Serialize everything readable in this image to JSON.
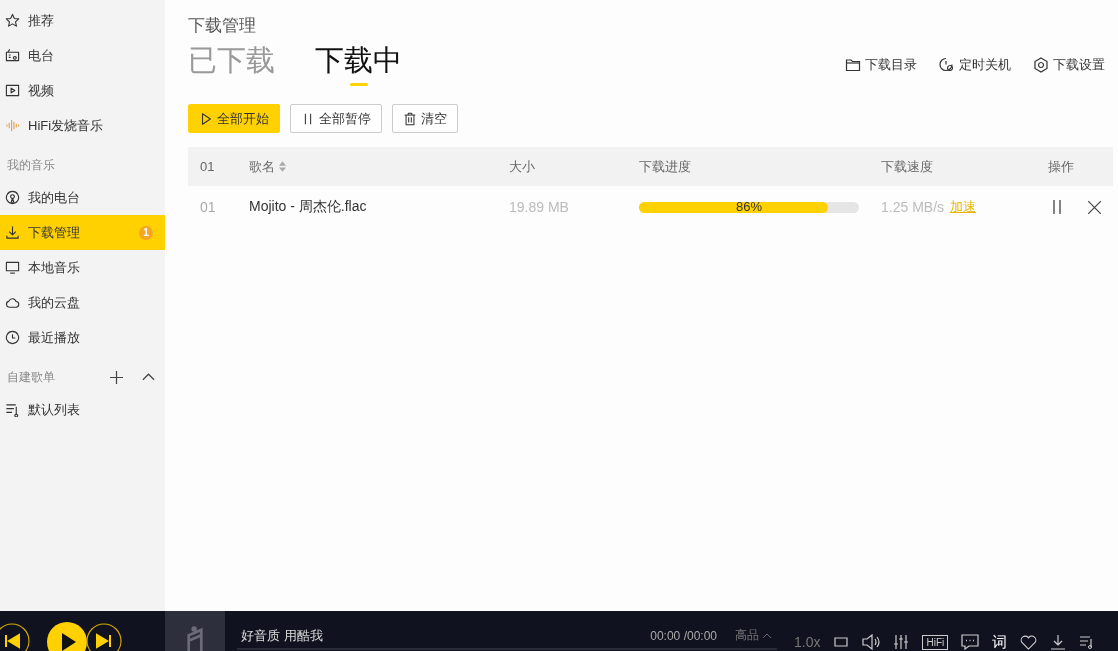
{
  "sidebar": {
    "groups": [
      {
        "items": [
          {
            "label": "推荐",
            "selected": false
          },
          {
            "label": "电台",
            "selected": false
          },
          {
            "label": "视频",
            "selected": false
          },
          {
            "label": "HiFi发烧音乐",
            "selected": false
          }
        ]
      },
      {
        "title": "我的音乐",
        "items": [
          {
            "label": "我的电台",
            "selected": false
          },
          {
            "label": "下载管理",
            "selected": true,
            "badge": "1"
          },
          {
            "label": "本地音乐",
            "selected": false
          },
          {
            "label": "我的云盘",
            "selected": false
          },
          {
            "label": "最近播放",
            "selected": false
          }
        ]
      },
      {
        "title": "自建歌单",
        "items": [
          {
            "label": "默认列表",
            "selected": false
          }
        ]
      }
    ]
  },
  "page": {
    "title": "下载管理",
    "tabs": [
      {
        "label": "已下载",
        "selected": false
      },
      {
        "label": "下载中",
        "selected": true
      }
    ],
    "links": [
      "下载目录",
      "定时关机",
      "下载设置"
    ],
    "buttons": [
      {
        "label": "全部开始",
        "kind": "primary"
      },
      {
        "label": "全部暂停",
        "kind": "outline"
      },
      {
        "label": "清空",
        "kind": "outline"
      }
    ]
  },
  "table": {
    "columns": [
      "01",
      "歌名",
      "大小",
      "下载进度",
      "下载速度",
      "操作"
    ],
    "rows": [
      {
        "index": "01",
        "name": "Mojito - 周杰伦.flac",
        "size": "19.89 MB",
        "level": 0.86,
        "progress": "86%",
        "speed": "1.25 MB/s",
        "boost": "加速"
      }
    ]
  },
  "player": {
    "song": "好音质 用酷我",
    "time": "00:00 /00:00",
    "quality": "高品",
    "rate": "1.0x",
    "hifi": "HiFi",
    "lyrics": "词"
  }
}
